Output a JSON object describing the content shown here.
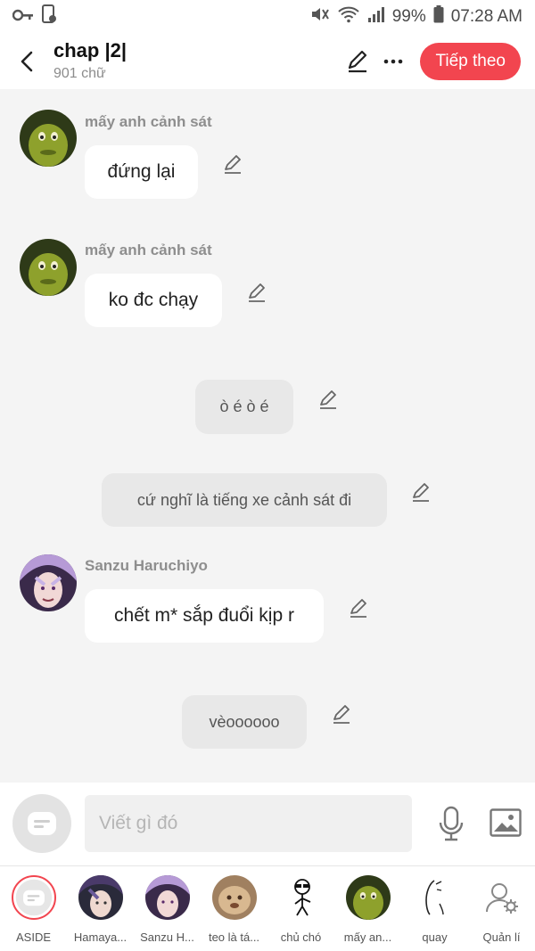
{
  "status_bar": {
    "battery": "99%",
    "time": "07:28 AM"
  },
  "header": {
    "title": "chap |2|",
    "word_count": "901 chữ",
    "next_label": "Tiếp theo"
  },
  "messages": [
    {
      "type": "character",
      "speaker": "mấy anh cảnh sát",
      "text": "đứng lại",
      "avatar": "shrek-avatar"
    },
    {
      "type": "character",
      "speaker": "mấy anh cảnh sát",
      "text": "ko đc chạy",
      "avatar": "shrek-avatar"
    },
    {
      "type": "narration",
      "text": "ò é ò é"
    },
    {
      "type": "narration",
      "text": "cứ nghĩ là tiếng xe cảnh sát đi"
    },
    {
      "type": "character",
      "speaker": "Sanzu Haruchiyo",
      "text": "chết m* sắp đuổi kịp r",
      "avatar": "anime-avatar"
    },
    {
      "type": "narration",
      "text": "vèoooooo"
    }
  ],
  "input": {
    "placeholder": "Viết gì đó"
  },
  "characters": [
    {
      "name": "ASIDE",
      "icon": "aside-icon"
    },
    {
      "name": "Hamaya...",
      "icon": "anime-avatar"
    },
    {
      "name": "Sanzu H...",
      "icon": "anime-avatar"
    },
    {
      "name": "teo là tá...",
      "icon": "blurry-avatar"
    },
    {
      "name": "chủ chó",
      "icon": "stickman-avatar"
    },
    {
      "name": "mấy an...",
      "icon": "shrek-avatar"
    },
    {
      "name": "quay",
      "icon": "sketch-avatar"
    },
    {
      "name": "Quản lí",
      "icon": "manage-icon"
    }
  ],
  "colors": {
    "accent": "#f2454f",
    "background": "#f4f4f4",
    "narration_bg": "#e8e8e8"
  }
}
